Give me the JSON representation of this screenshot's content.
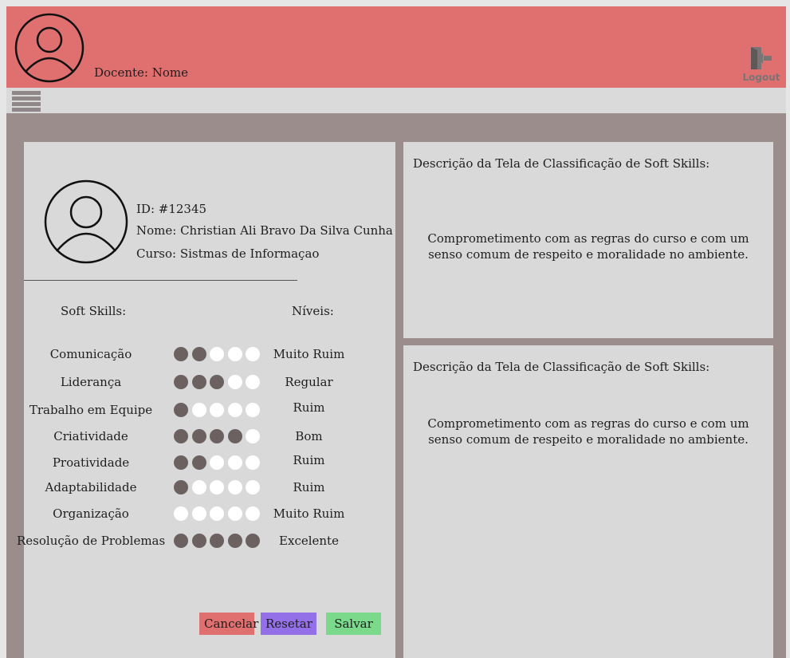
{
  "header": {
    "docente_label": "Docente: Nome",
    "logout_label": "Logout",
    "icons": {
      "avatar": "user-circle-icon",
      "logout": "logout-door-icon",
      "menu": "hamburger-menu-icon"
    }
  },
  "student": {
    "id": "ID: #12345",
    "name": "Nome: Christian Ali Bravo Da Silva Cunha",
    "course": "Curso: Sistmas de Informaçao"
  },
  "columns": {
    "skills": "Soft Skills:",
    "levels": "Níveis:"
  },
  "skills": [
    {
      "name": "Comunicação",
      "rating": 2,
      "level": "Muito Ruim"
    },
    {
      "name": "Liderança",
      "rating": 3,
      "level": "Regular"
    },
    {
      "name": "Trabalho em Equipe",
      "rating": 1,
      "level": "Ruim"
    },
    {
      "name": "Criatividade",
      "rating": 4,
      "level": "Bom"
    },
    {
      "name": "Proatividade",
      "rating": 2,
      "level": "Ruim"
    },
    {
      "name": "Adaptabilidade",
      "rating": 1,
      "level": "Ruim"
    },
    {
      "name": "Organização",
      "rating": 0,
      "level": "Muito Ruim"
    },
    {
      "name": "Resolução de Problemas",
      "rating": 5,
      "level": "Excelente"
    }
  ],
  "rating_max": 5,
  "buttons": {
    "cancel": "Cancelar",
    "reset": "Resetar",
    "save": "Salvar"
  },
  "descriptions": [
    {
      "title": "Descrição da Tela de Classificação de Soft Skills:",
      "line1": "Comprometimento com as regras do curso e com um",
      "line2": "senso comum de respeito e moralidade no ambiente."
    },
    {
      "title": "Descrição da Tela de Classificação de Soft Skills:",
      "line1": "Comprometimento com as regras do curso e com um",
      "line2": "senso comum de respeito e moralidade no ambiente."
    }
  ],
  "colors": {
    "header": "#e07070",
    "frame": "#9a8d8b",
    "panel": "#d9d9d9",
    "dot_filled": "#6b6161",
    "dot_empty": "#ffffff",
    "cancel": "#e07070",
    "reset": "#9370e8",
    "save": "#7ad98a"
  }
}
